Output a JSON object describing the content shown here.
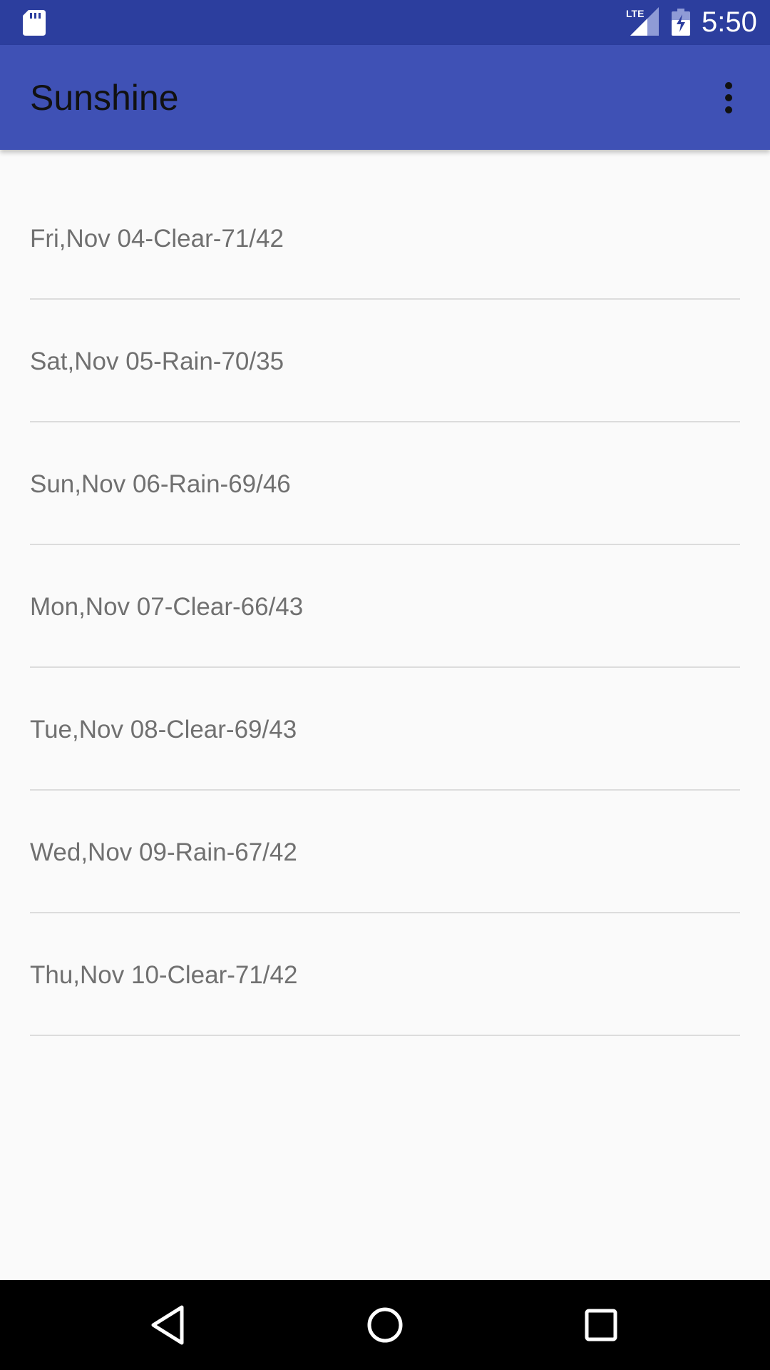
{
  "status_bar": {
    "time": "5:50",
    "network_label": "LTE",
    "icons": [
      "sd-card-icon",
      "lte-signal-icon",
      "battery-charging-icon"
    ],
    "color": "#2c3e9e"
  },
  "app_bar": {
    "title": "Sunshine",
    "menu_icon": "more-vert-icon",
    "color": "#3f51b5"
  },
  "forecast": {
    "items": [
      {
        "label": "Fri,Nov 04-Clear-71/42"
      },
      {
        "label": "Sat,Nov 05-Rain-70/35"
      },
      {
        "label": "Sun,Nov 06-Rain-69/46"
      },
      {
        "label": "Mon,Nov 07-Clear-66/43"
      },
      {
        "label": "Tue,Nov 08-Clear-69/43"
      },
      {
        "label": "Wed,Nov 09-Rain-67/42"
      },
      {
        "label": "Thu,Nov 10-Clear-71/42"
      }
    ]
  },
  "nav_bar": {
    "buttons": [
      "back-icon",
      "home-icon",
      "recents-icon"
    ]
  }
}
